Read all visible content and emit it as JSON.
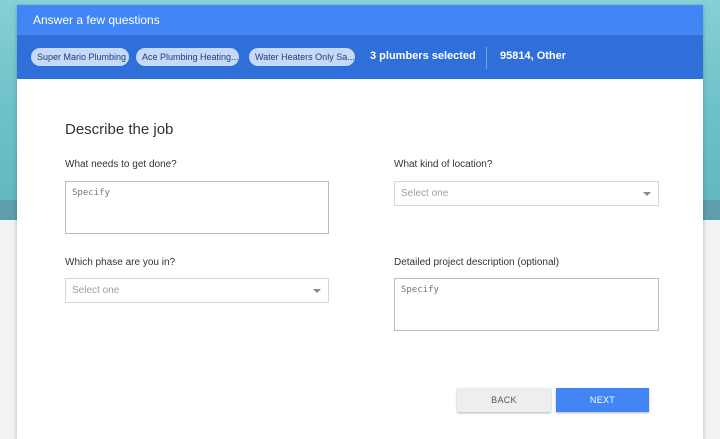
{
  "header": {
    "title": "Answer a few questions"
  },
  "chips": {
    "items": [
      {
        "label": "Super Mario Plumbing"
      },
      {
        "label": "Ace Plumbing Heating..."
      },
      {
        "label": "Water Heaters Only Sa..."
      }
    ],
    "count_label": "3 plumbers selected",
    "location_label": "95814, Other"
  },
  "form": {
    "section_title": "Describe the job",
    "fields": {
      "what_needs": {
        "label": "What needs to get done?",
        "placeholder": "Specify",
        "value": ""
      },
      "location_kind": {
        "label": "What kind of location?",
        "value": "Select one"
      },
      "phase": {
        "label": "Which phase are you in?",
        "value": "Select one"
      },
      "description": {
        "label": "Detailed project description (optional)",
        "placeholder": "Specify",
        "value": ""
      }
    }
  },
  "actions": {
    "back_label": "BACK",
    "next_label": "NEXT"
  },
  "colors": {
    "header_blue": "#4285f4",
    "chip_bar_blue": "#2f6fd9",
    "chip_bg": "#c6d9f8",
    "next_button": "#4285f4"
  }
}
